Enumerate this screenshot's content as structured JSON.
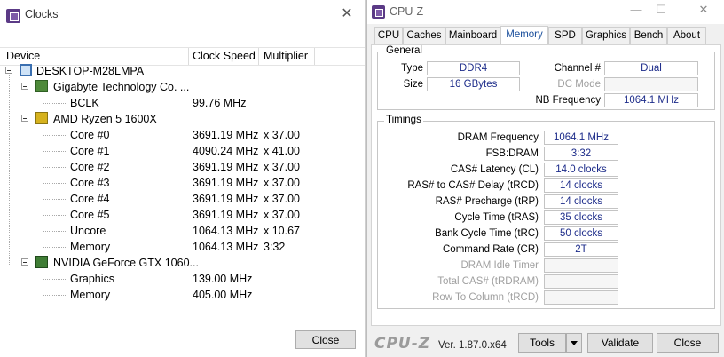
{
  "clocks": {
    "title": "Clocks",
    "columns": {
      "device": "Device",
      "speed": "Clock Speed",
      "multiplier": "Multiplier"
    },
    "rows": [
      {
        "label": "DESKTOP-M28LMPA",
        "speed": "",
        "mult": "",
        "icon": "computer-icon"
      },
      {
        "label": "Gigabyte Technology Co. ...",
        "speed": "",
        "mult": "",
        "icon": "motherboard-icon"
      },
      {
        "label": "BCLK",
        "speed": "99.76 MHz",
        "mult": ""
      },
      {
        "label": "AMD Ryzen 5 1600X",
        "speed": "",
        "mult": "",
        "icon": "cpu-icon"
      },
      {
        "label": "Core #0",
        "speed": "3691.19 MHz",
        "mult": "x 37.00"
      },
      {
        "label": "Core #1",
        "speed": "4090.24 MHz",
        "mult": "x 41.00"
      },
      {
        "label": "Core #2",
        "speed": "3691.19 MHz",
        "mult": "x 37.00"
      },
      {
        "label": "Core #3",
        "speed": "3691.19 MHz",
        "mult": "x 37.00"
      },
      {
        "label": "Core #4",
        "speed": "3691.19 MHz",
        "mult": "x 37.00"
      },
      {
        "label": "Core #5",
        "speed": "3691.19 MHz",
        "mult": "x 37.00"
      },
      {
        "label": "Uncore",
        "speed": "1064.13 MHz",
        "mult": "x 10.67"
      },
      {
        "label": "Memory",
        "speed": "1064.13 MHz",
        "mult": "3:32"
      },
      {
        "label": "NVIDIA GeForce GTX 1060...",
        "speed": "",
        "mult": "",
        "icon": "gpu-icon"
      },
      {
        "label": "Graphics",
        "speed": "139.00 MHz",
        "mult": ""
      },
      {
        "label": "Memory",
        "speed": "405.00 MHz",
        "mult": ""
      }
    ],
    "close_label": "Close"
  },
  "cpuz": {
    "title": "CPU-Z",
    "tabs": [
      "CPU",
      "Caches",
      "Mainboard",
      "Memory",
      "SPD",
      "Graphics",
      "Bench",
      "About"
    ],
    "active_tab": "Memory",
    "general": {
      "label": "General",
      "type_label": "Type",
      "type_value": "DDR4",
      "size_label": "Size",
      "size_value": "16 GBytes",
      "channel_label": "Channel #",
      "channel_value": "Dual",
      "dc_label": "DC Mode",
      "dc_value": "",
      "nb_label": "NB Frequency",
      "nb_value": "1064.1 MHz"
    },
    "timings": {
      "label": "Timings",
      "rows": [
        {
          "label": "DRAM Frequency",
          "value": "1064.1 MHz",
          "enabled": true
        },
        {
          "label": "FSB:DRAM",
          "value": "3:32",
          "enabled": true
        },
        {
          "label": "CAS# Latency (CL)",
          "value": "14.0 clocks",
          "enabled": true
        },
        {
          "label": "RAS# to CAS# Delay (tRCD)",
          "value": "14 clocks",
          "enabled": true
        },
        {
          "label": "RAS# Precharge (tRP)",
          "value": "14 clocks",
          "enabled": true
        },
        {
          "label": "Cycle Time (tRAS)",
          "value": "35 clocks",
          "enabled": true
        },
        {
          "label": "Bank Cycle Time (tRC)",
          "value": "50 clocks",
          "enabled": true
        },
        {
          "label": "Command Rate (CR)",
          "value": "2T",
          "enabled": true
        },
        {
          "label": "DRAM Idle Timer",
          "value": "",
          "enabled": false
        },
        {
          "label": "Total CAS# (tRDRAM)",
          "value": "",
          "enabled": false
        },
        {
          "label": "Row To Column (tRCD)",
          "value": "",
          "enabled": false
        }
      ]
    },
    "footer": {
      "logo": "CPU-Z",
      "version": "Ver. 1.87.0.x64",
      "tools_label": "Tools",
      "validate_label": "Validate",
      "close_label": "Close"
    }
  }
}
